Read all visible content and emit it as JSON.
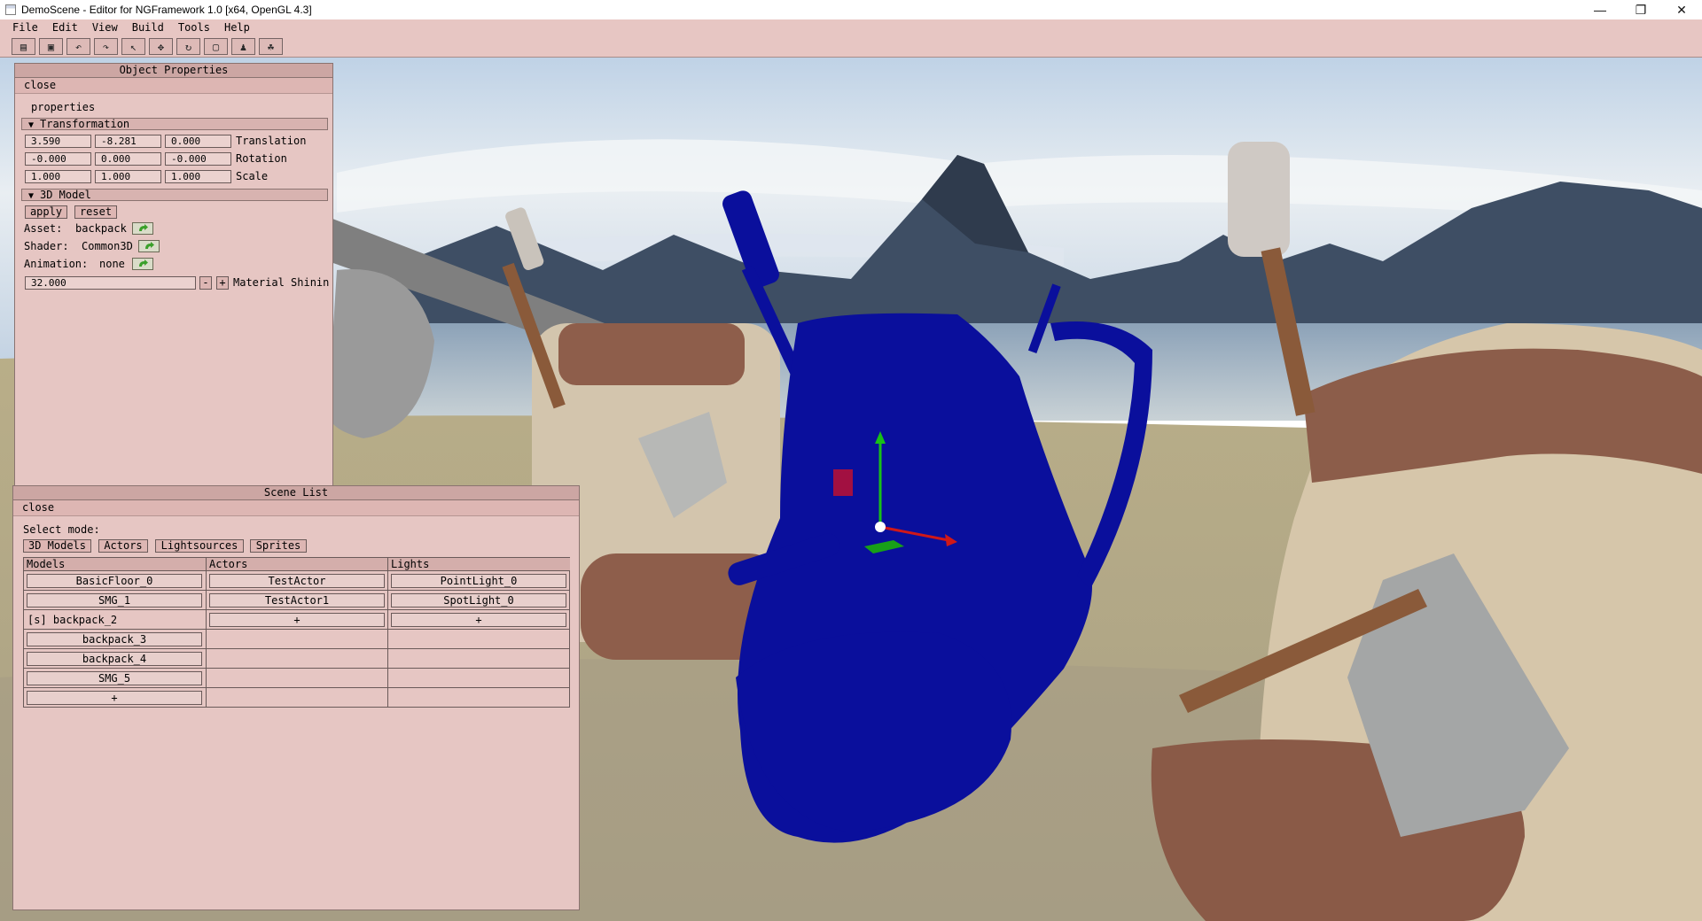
{
  "window": {
    "title": "DemoScene - Editor for NGFramework 1.0 [x64, OpenGL 4.3]",
    "minimize": "—",
    "restore": "❐",
    "close": "✕"
  },
  "menu": [
    "File",
    "Edit",
    "View",
    "Build",
    "Tools",
    "Help"
  ],
  "toolbar": {
    "icons": [
      "new-scene-icon",
      "save-icon",
      "undo-icon",
      "redo-icon",
      "select-cursor-icon",
      "move-icon",
      "rotate-icon",
      "scale-icon",
      "add-actor-icon",
      "add-light-icon"
    ],
    "glyphs": [
      "▤",
      "▣",
      "↶",
      "↷",
      "↖",
      "✥",
      "↻",
      "▢",
      "♟",
      "☘"
    ]
  },
  "object_properties": {
    "title": "Object Properties",
    "close": "close",
    "properties_label": "properties",
    "transformation": {
      "header": "Transformation",
      "translation": [
        "3.590",
        "-8.281",
        "0.000"
      ],
      "translation_label": "Translation",
      "rotation": [
        "-0.000",
        "0.000",
        "-0.000"
      ],
      "rotation_label": "Rotation",
      "scale": [
        "1.000",
        "1.000",
        "1.000"
      ],
      "scale_label": "Scale"
    },
    "model": {
      "header": "3D Model",
      "apply": "apply",
      "reset": "reset",
      "asset_label": "Asset:",
      "asset_value": "backpack",
      "shader_label": "Shader:",
      "shader_value": "Common3D",
      "animation_label": "Animation:",
      "animation_value": "none",
      "shininess_value": "32.000",
      "minus": "-",
      "plus": "+",
      "shininess_label": "Material Shinin"
    }
  },
  "scene_list": {
    "title": "Scene List",
    "close": "close",
    "select_mode_label": "Select mode:",
    "modes": [
      "3D Models",
      "Actors",
      "Lightsources",
      "Sprites"
    ],
    "columns": [
      "Models",
      "Actors",
      "Lights"
    ],
    "models": [
      "BasicFloor_0",
      "SMG_1",
      "[s] backpack_2",
      "backpack_3",
      "backpack_4",
      "SMG_5",
      "+"
    ],
    "actors": [
      "TestActor",
      "TestActor1",
      "+"
    ],
    "lights": [
      "PointLight_0",
      "SpotLight_0",
      "+"
    ]
  },
  "colors": {
    "panel_bg": "#e6c6c3",
    "selected_model": "#0a0f9c",
    "axis_x": "#d01818",
    "axis_y": "#18c018",
    "axis_z": "#18a018"
  }
}
